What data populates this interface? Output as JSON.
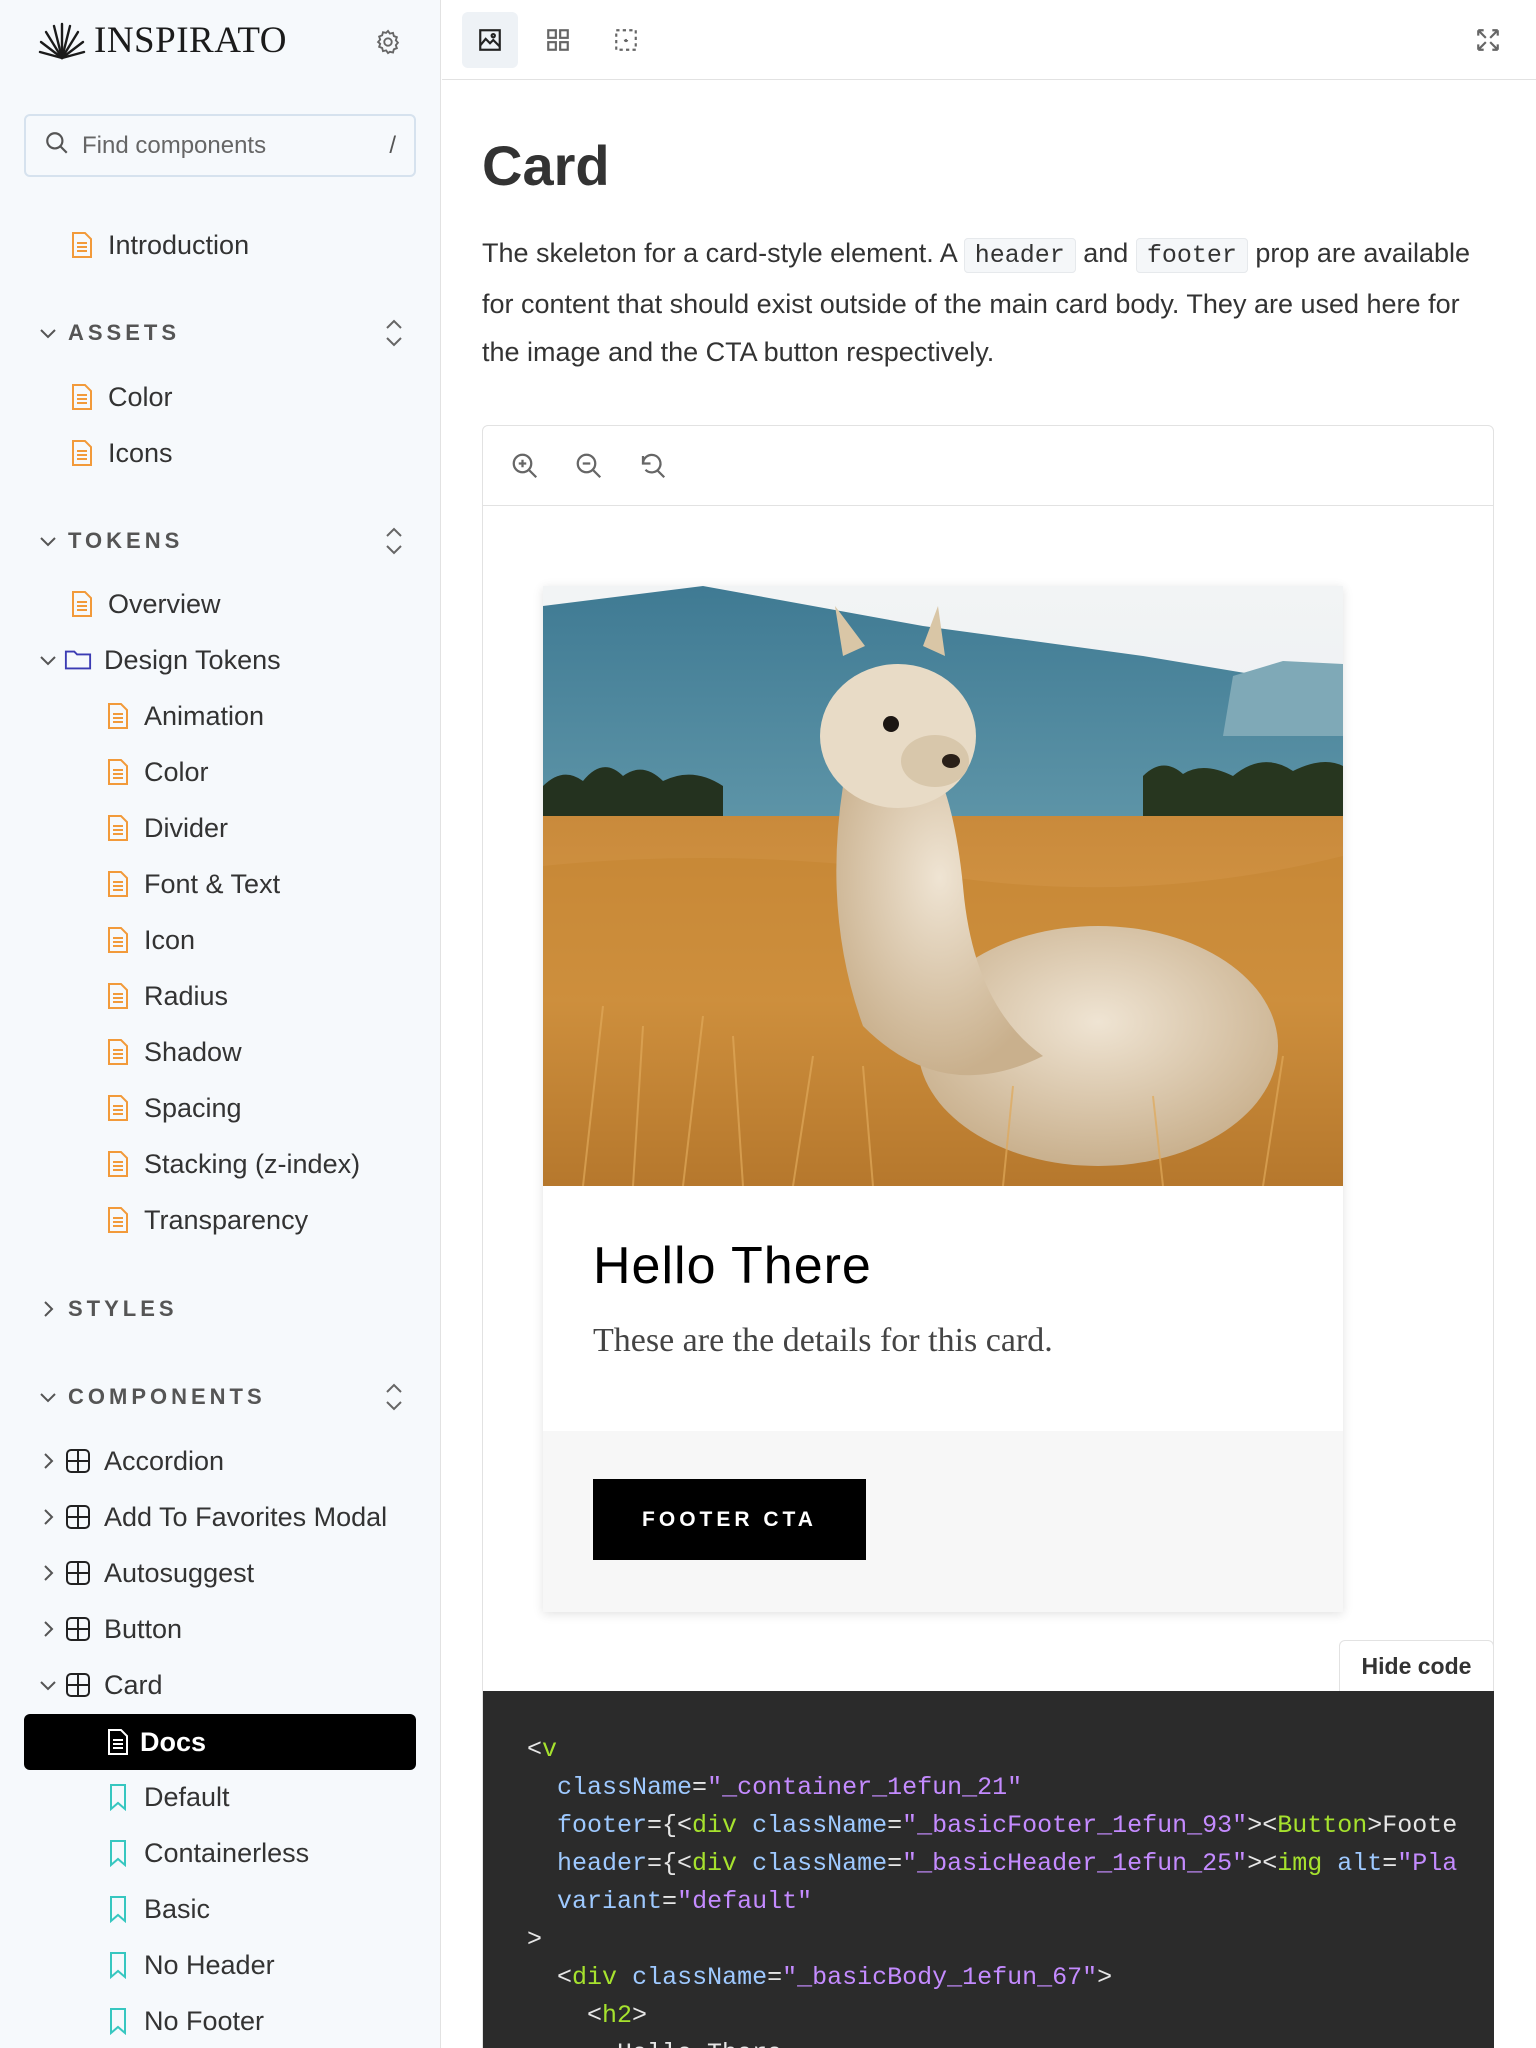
{
  "brand": {
    "name": "INSPIRATO"
  },
  "search": {
    "placeholder": "Find components",
    "shortcut": "/"
  },
  "sidebar": {
    "intro": "Introduction",
    "sections": {
      "assets": {
        "label": "ASSETS",
        "items": [
          "Color",
          "Icons"
        ]
      },
      "tokens": {
        "label": "TOKENS",
        "overview": "Overview",
        "folder": "Design Tokens",
        "items": [
          "Animation",
          "Color",
          "Divider",
          "Font & Text",
          "Icon",
          "Radius",
          "Shadow",
          "Spacing",
          "Stacking (z-index)",
          "Transparency"
        ]
      },
      "styles": {
        "label": "STYLES"
      },
      "components": {
        "label": "COMPONENTS",
        "items": [
          "Accordion",
          "Add To Favorites Modal",
          "Autosuggest",
          "Button",
          "Card"
        ],
        "card_children": [
          "Docs",
          "Default",
          "Containerless",
          "Basic",
          "No Header",
          "No Footer"
        ]
      }
    }
  },
  "main": {
    "title": "Card",
    "desc_parts": [
      "The skeleton for a card-style element. A ",
      "header",
      " and ",
      "footer",
      " prop are available for content that should exist outside of the main card body. They are used here for the image and the CTA button respectively."
    ],
    "card": {
      "title": "Hello There",
      "text": "These are the details for this card.",
      "cta": "FOOTER CTA"
    },
    "hide_code": "Hide code",
    "code": {
      "l1_open": "<",
      "l1_tag": "v",
      "l2_attr": "className",
      "l2_val": "\"_container_1efun_21\"",
      "l3_attr": "footer",
      "l3_rest_a": "={<",
      "l3_tag": "div",
      "l3_attr2": "className",
      "l3_val": "\"_basicFooter_1efun_93\"",
      "l3_rest_b": "><",
      "l3_tag2": "Button",
      "l3_rest_c": ">Foote",
      "l4_attr": "header",
      "l4_rest_a": "={<",
      "l4_tag": "div",
      "l4_attr2": "className",
      "l4_val": "\"_basicHeader_1efun_25\"",
      "l4_rest_b": "><",
      "l4_tag2": "img",
      "l4_attr3": "alt",
      "l4_val2": "\"Pla",
      "l5_attr": "variant",
      "l5_val": "\"default\"",
      "l6": ">",
      "l7_open": "<",
      "l7_tag": "div",
      "l7_attr": "className",
      "l7_val": "\"_basicBody_1efun_67\"",
      "l7_close": ">",
      "l8_open": "<",
      "l8_tag": "h2",
      "l8_close": ">",
      "l9": "Hello There"
    }
  },
  "colors": {
    "doc_icon": "#f29a3a",
    "folder_icon": "#3b3bb3",
    "story_icon": "#37c7c0",
    "active_bg": "#000000"
  },
  "icons": {
    "brand": "palm-leaf-logo-icon",
    "settings": "gear-icon",
    "search": "search-icon",
    "doc": "document-icon",
    "folder": "folder-icon",
    "component": "component-grid-icon",
    "story": "bookmark-icon",
    "toolbar": [
      "image-icon",
      "grid-icon",
      "outline-icon",
      "fullscreen-icon"
    ],
    "zoom": [
      "zoom-in-icon",
      "zoom-out-icon",
      "reset-zoom-icon"
    ]
  }
}
